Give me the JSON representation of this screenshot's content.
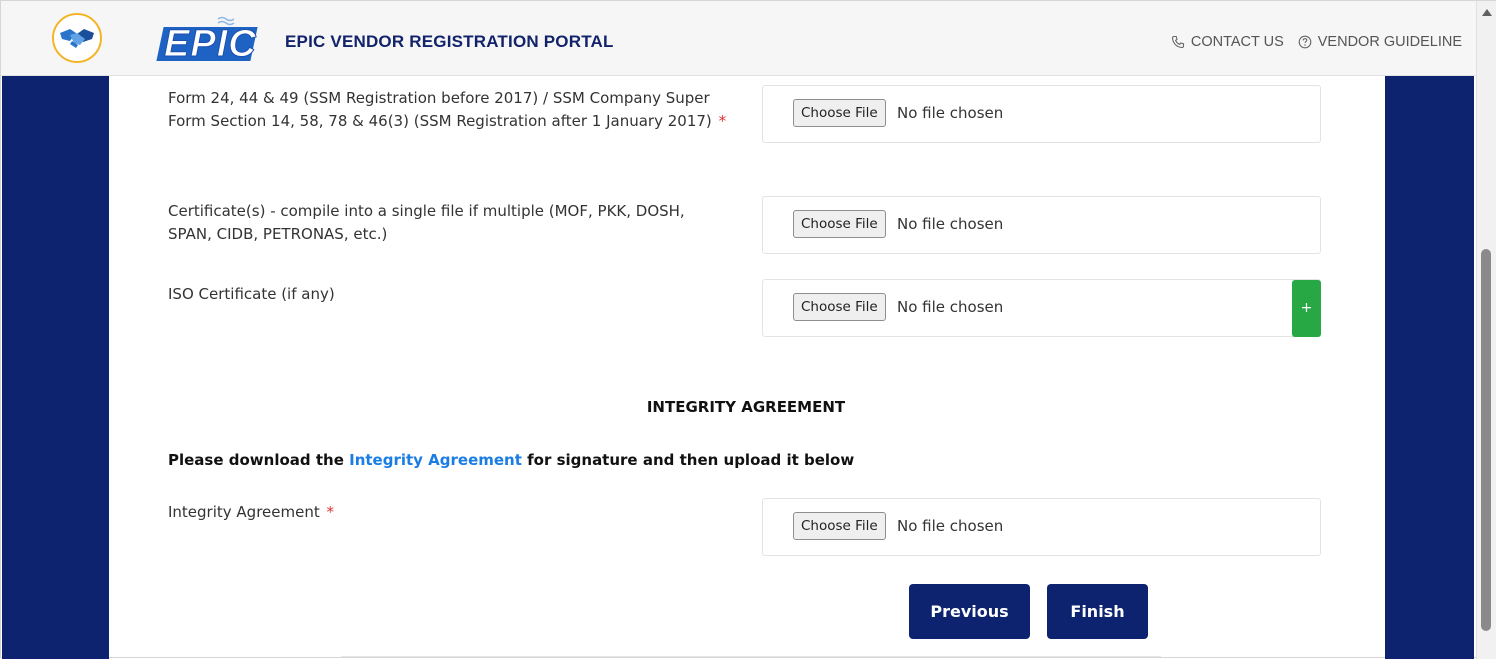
{
  "header": {
    "portal_title": "EPIC VENDOR REGISTRATION PORTAL",
    "logo_text": "EPIC",
    "contact_label": "CONTACT US",
    "guideline_label": "VENDOR GUIDELINE"
  },
  "form": {
    "fields": [
      {
        "label": "Form 24, 44 & 49 (SSM Registration before 2017) / SSM Company Super Form Section 14, 58, 78 & 46(3) (SSM Registration after 1 January 2017)",
        "required_mark": "*",
        "button_label": "Choose File",
        "status": "No file chosen"
      },
      {
        "label": "Certificate(s) - compile into a single file if multiple (MOF, PKK, DOSH, SPAN, CIDB, PETRONAS, etc.)",
        "button_label": "Choose File",
        "status": "No file chosen"
      },
      {
        "label": "ISO Certificate (if any)",
        "button_label": "Choose File",
        "status": "No file chosen",
        "add_label": "+"
      }
    ],
    "integrity": {
      "section_title": "INTEGRITY AGREEMENT",
      "instruction_before": "Please download the ",
      "instruction_link": "Integrity Agreement",
      "instruction_after": " for signature and then upload it below",
      "field_label": "Integrity Agreement",
      "required_mark": "*",
      "button_label": "Choose File",
      "status": "No file chosen"
    }
  },
  "actions": {
    "previous_label": "Previous",
    "finish_label": "Finish"
  },
  "colors": {
    "navy": "#0e236f",
    "link_blue": "#1a7de3",
    "add_green": "#28a745",
    "required_red": "#e03131"
  }
}
